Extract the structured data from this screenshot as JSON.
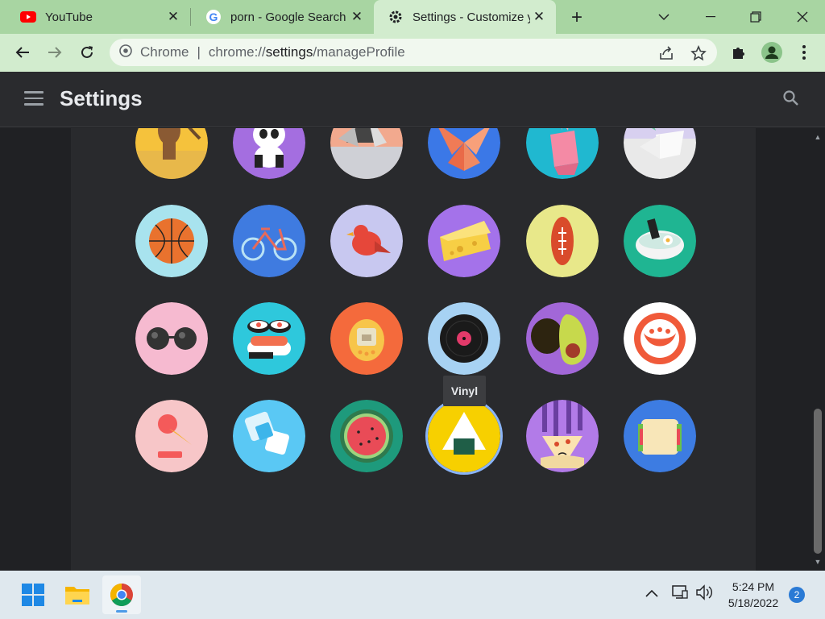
{
  "browser": {
    "tabs": [
      {
        "title": "YouTube",
        "icon": "youtube-icon",
        "active": false
      },
      {
        "title": "porn - Google Search",
        "icon": "google-icon",
        "active": false
      },
      {
        "title": "Settings - Customize your Chrome profile",
        "icon": "gear-icon",
        "active": true
      }
    ],
    "omnibox": {
      "site_label": "Chrome",
      "url_prefix": "chrome://",
      "url_host": "settings",
      "url_path": "/manageProfile"
    },
    "colors": {
      "tab_strip": "#a8d5a2",
      "toolbar": "#d2ecce",
      "accent": "#8ab4f8"
    }
  },
  "settings": {
    "title": "Settings",
    "avatars": [
      {
        "name": "Monkey",
        "bg": "#f5c23c",
        "icon": "monkey-avatar"
      },
      {
        "name": "Panda",
        "bg": "#a46ee0",
        "icon": "panda-avatar"
      },
      {
        "name": "Penguin",
        "bg": "#f2a98e",
        "icon": "penguin-avatar"
      },
      {
        "name": "Butterfly",
        "bg": "#3b78e7",
        "icon": "butterfly-avatar"
      },
      {
        "name": "Rabbit",
        "bg": "#20b8d0",
        "icon": "rabbit-avatar"
      },
      {
        "name": "Unicorn",
        "bg": "#e9e9e9",
        "icon": "unicorn-avatar"
      },
      {
        "name": "Basketball",
        "bg": "#a8e3ee",
        "icon": "basketball-avatar"
      },
      {
        "name": "Bike",
        "bg": "#3f7be0",
        "icon": "bike-avatar"
      },
      {
        "name": "Bird",
        "bg": "#c8c8f0",
        "icon": "bird-avatar"
      },
      {
        "name": "Cheese",
        "bg": "#a472ea",
        "icon": "cheese-avatar"
      },
      {
        "name": "Football",
        "bg": "#e8e88a",
        "icon": "football-avatar"
      },
      {
        "name": "Ramen",
        "bg": "#1fb592",
        "icon": "ramen-avatar"
      },
      {
        "name": "Sunglasses",
        "bg": "#f6bad0",
        "icon": "sunglasses-avatar"
      },
      {
        "name": "Sushi",
        "bg": "#2ec8dc",
        "icon": "sushi-avatar"
      },
      {
        "name": "Tamagotchi",
        "bg": "#f46a3c",
        "icon": "tamagotchi-avatar"
      },
      {
        "name": "Vinyl",
        "bg": "#a7d2f3",
        "icon": "vinyl-avatar"
      },
      {
        "name": "Avocado",
        "bg": "#a267d8",
        "icon": "avocado-avatar"
      },
      {
        "name": "Cappuccino",
        "bg": "#ffffff",
        "icon": "cappuccino-avatar"
      },
      {
        "name": "Ice cream",
        "bg": "#f7c6c8",
        "icon": "icecream-avatar"
      },
      {
        "name": "Ice water",
        "bg": "#5ac8f4",
        "icon": "icewater-avatar"
      },
      {
        "name": "Watermelon",
        "bg": "#1e9a7c",
        "icon": "watermelon-avatar"
      },
      {
        "name": "Onigiri",
        "bg": "#f7d000",
        "icon": "onigiri-avatar"
      },
      {
        "name": "Pizza",
        "bg": "#b27be8",
        "icon": "pizza-avatar"
      },
      {
        "name": "Sandwich",
        "bg": "#3d7ce2",
        "icon": "sandwich-avatar"
      }
    ],
    "tooltip": "Vinyl",
    "selected": "Onigiri"
  },
  "taskbar": {
    "apps": [
      "windows-start-icon",
      "file-explorer-icon",
      "chrome-icon"
    ],
    "time": "5:24 PM",
    "date": "5/18/2022",
    "notifications": "2"
  }
}
